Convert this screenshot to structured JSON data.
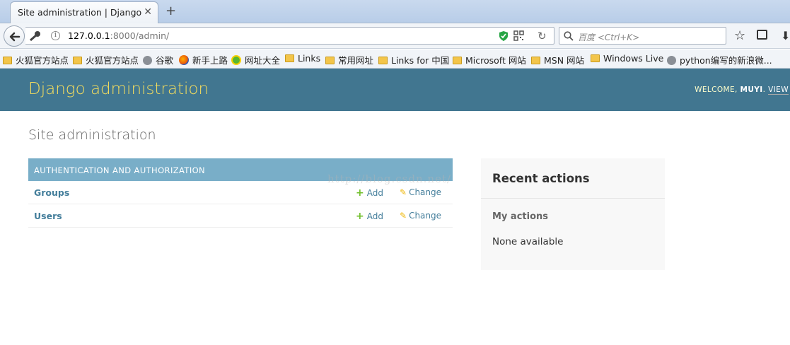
{
  "browser": {
    "tab_title": "Site administration | Django...",
    "tab_close": "✕",
    "new_tab": "+",
    "url_host": "127.0.0.1",
    "url_path": ":8000/admin/",
    "search_placeholder": "百度 <Ctrl+K>",
    "bookmarks": [
      {
        "label": "火狐官方站点",
        "icon": "folder-icon"
      },
      {
        "label": "火狐官方站点",
        "icon": "folder-icon"
      },
      {
        "label": "谷歌",
        "icon": "globe-icon"
      },
      {
        "label": "新手上路",
        "icon": "firefox-icon"
      },
      {
        "label": "网址大全",
        "icon": "nav360-icon"
      },
      {
        "label": "Links",
        "icon": "folder-icon"
      },
      {
        "label": "常用网址",
        "icon": "folder-icon"
      },
      {
        "label": "Links for 中国",
        "icon": "folder-icon"
      },
      {
        "label": "Microsoft 网站",
        "icon": "folder-icon"
      },
      {
        "label": "MSN 网站",
        "icon": "folder-icon"
      },
      {
        "label": "Windows Live",
        "icon": "folder-icon"
      },
      {
        "label": "python编写的新浪微...",
        "icon": "globe-icon"
      }
    ]
  },
  "header": {
    "brand": "Django administration",
    "welcome": "WELCOME, ",
    "username": "MUYI",
    "separator": ". ",
    "view_site": "VIEW"
  },
  "content": {
    "title": "Site administration",
    "app_caption": "AUTHENTICATION AND AUTHORIZATION",
    "models": [
      {
        "name": "Groups",
        "add": "Add",
        "change": "Change"
      },
      {
        "name": "Users",
        "add": "Add",
        "change": "Change"
      }
    ],
    "watermark": "http://blog.csdn.net/"
  },
  "recent": {
    "title": "Recent actions",
    "my_actions": "My actions",
    "none_available": "None available"
  },
  "colors": {
    "header_bg": "#417690",
    "brand": "#f5dd5d",
    "caption_bg": "#79aec8",
    "link": "#447e9b"
  }
}
